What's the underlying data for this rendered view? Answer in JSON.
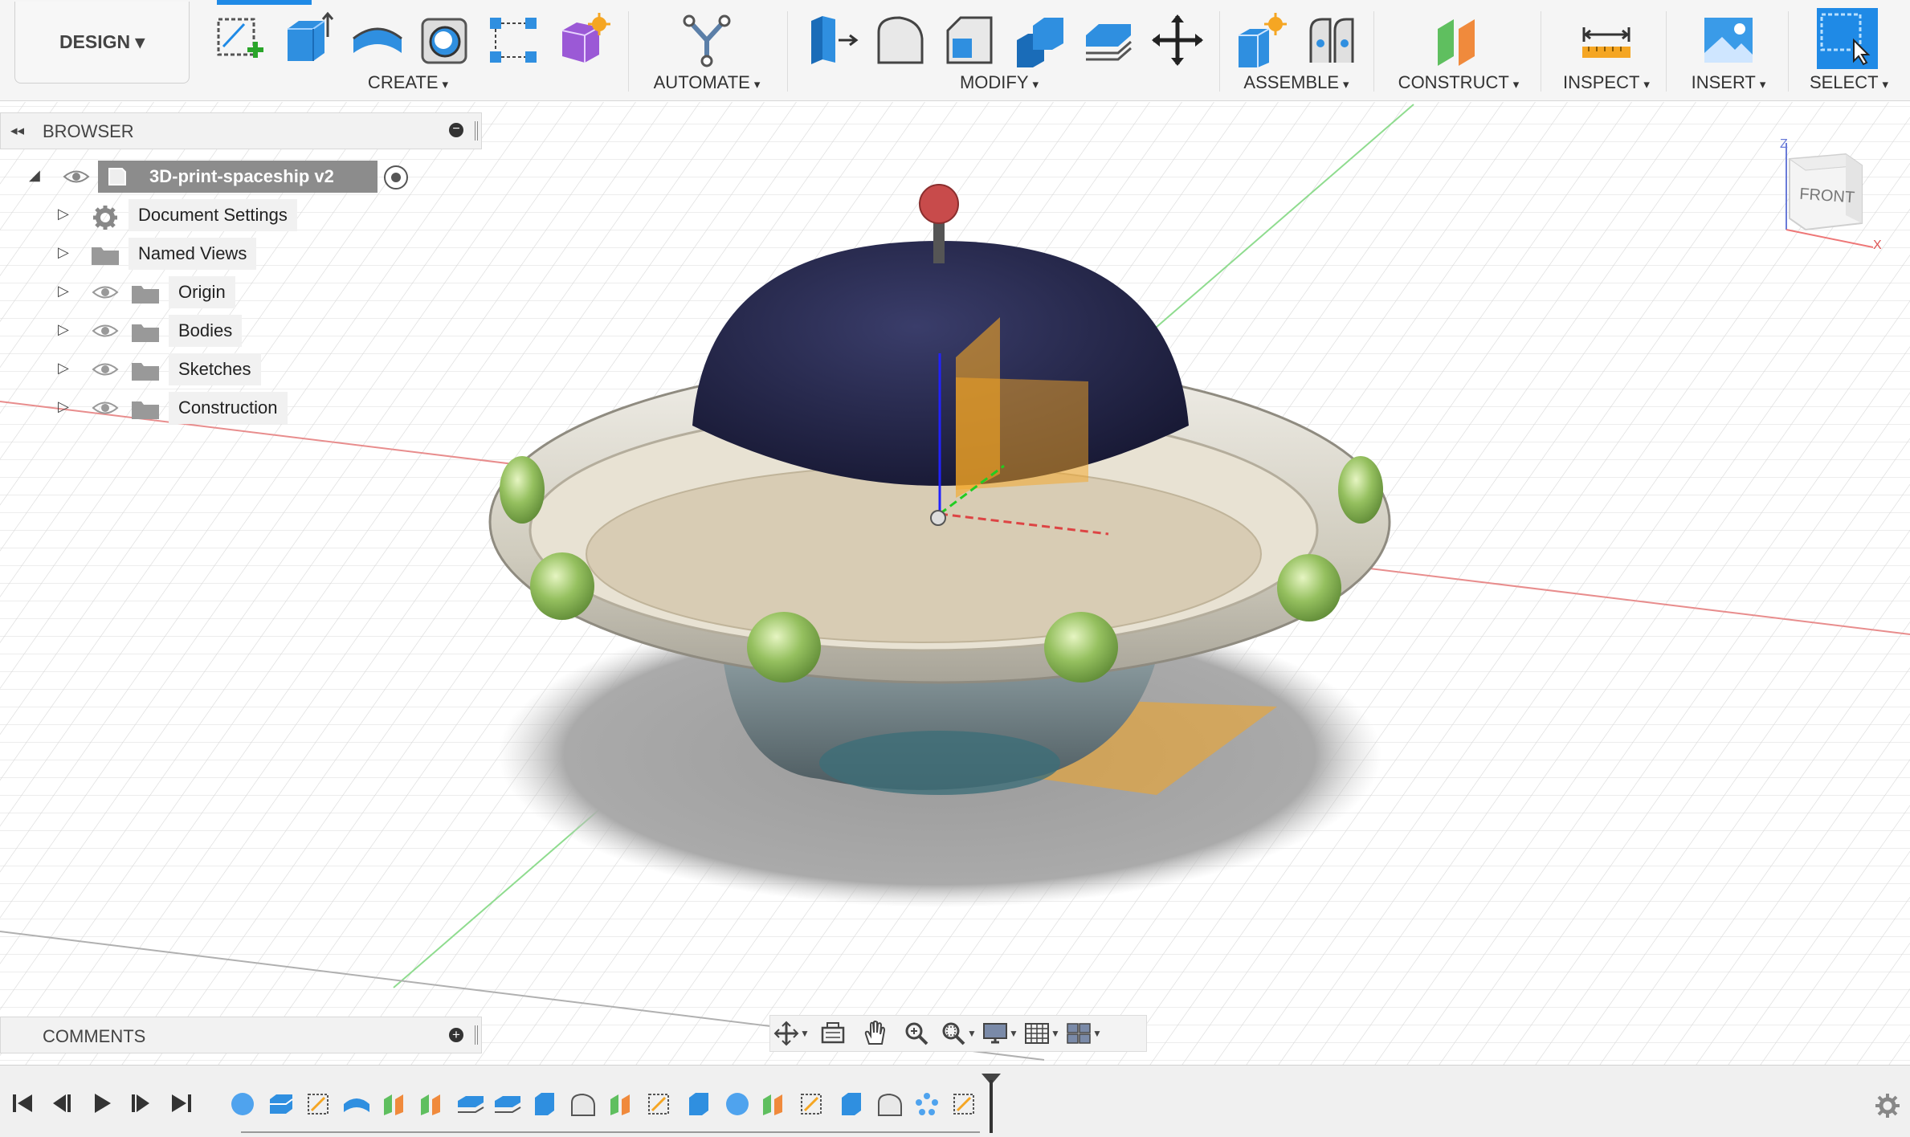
{
  "toolbar": {
    "design_label": "DESIGN ▾",
    "groups": {
      "create": "CREATE",
      "automate": "AUTOMATE",
      "modify": "MODIFY",
      "assemble": "ASSEMBLE",
      "construct": "CONSTRUCT",
      "inspect": "INSPECT",
      "insert": "INSERT",
      "select": "SELECT"
    },
    "dropdown_arrow": "▾"
  },
  "browser": {
    "title": "BROWSER",
    "root": "3D-print-spaceship v2",
    "items": [
      {
        "label": "Document Settings"
      },
      {
        "label": "Named Views"
      },
      {
        "label": "Origin"
      },
      {
        "label": "Bodies"
      },
      {
        "label": "Sketches"
      },
      {
        "label": "Construction"
      }
    ]
  },
  "comments": {
    "title": "COMMENTS"
  },
  "viewcube": {
    "face": "FRONT",
    "axis_z": "Z",
    "axis_x": "X"
  },
  "colors": {
    "accent": "#1f8ae6",
    "toolbar_bg": "#f5f5f5",
    "construction_plane": "#f5a623",
    "dome": "#2b2d4e",
    "saucer": "#d9d6cc",
    "lights": "#8fb65f"
  },
  "timeline": {
    "controls": [
      "first-icon",
      "prev-icon",
      "play-icon",
      "next-icon",
      "last-icon"
    ],
    "feature_count": 20
  }
}
